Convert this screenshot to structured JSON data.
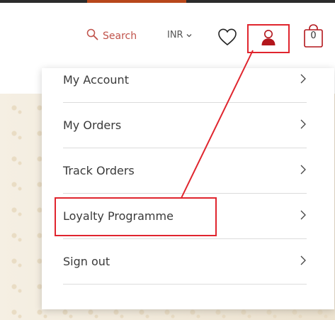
{
  "header": {
    "search_label": "Search",
    "currency": "INR",
    "cart_count": "0",
    "icons": {
      "search": "search-icon",
      "currency_chevron": "chevron-down-icon",
      "wishlist": "heart-icon",
      "account": "user-icon",
      "cart": "shopping-bag-icon"
    },
    "colors": {
      "search_text": "#c0524a",
      "account_icon": "#b3161c",
      "highlight": "#e0252e"
    }
  },
  "account_menu": {
    "items": [
      {
        "label": "My Account"
      },
      {
        "label": "My Orders"
      },
      {
        "label": "Track Orders"
      },
      {
        "label": "Loyalty Programme"
      },
      {
        "label": "Sign out"
      }
    ]
  }
}
